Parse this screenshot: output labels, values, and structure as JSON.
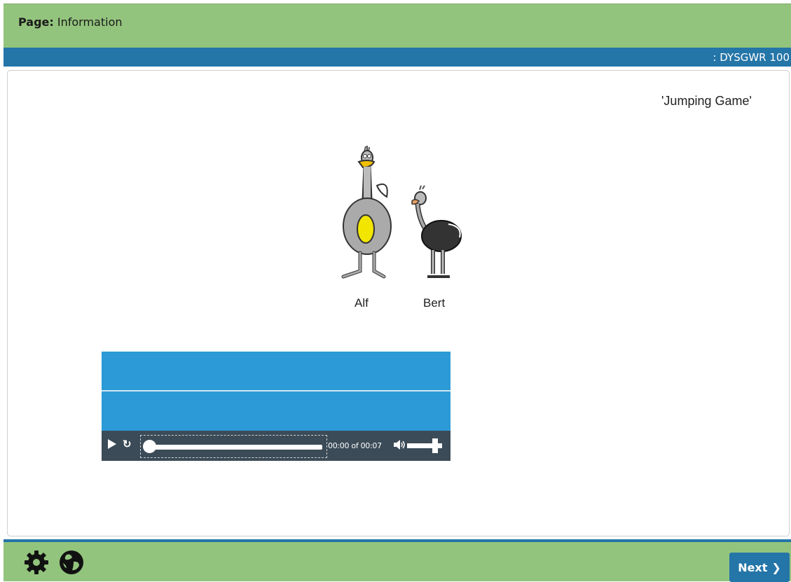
{
  "header": {
    "page_prefix": "Page:",
    "page_name": "Information",
    "course_code": ": DYSGWR 100"
  },
  "content": {
    "title": "'Jumping Game'",
    "characters": [
      {
        "name": "Alf",
        "icon": "tall-grey-ostrich-illustration"
      },
      {
        "name": "Bert",
        "icon": "small-black-ostrich-illustration"
      }
    ]
  },
  "player": {
    "time": "00:00 of 00:07",
    "progress": 0,
    "volume": 0.8,
    "icons": [
      "play-icon",
      "repeat-icon",
      "volume-icon"
    ]
  },
  "footer": {
    "icons": [
      "gear-icon",
      "globe-icon"
    ],
    "next_label": "Next",
    "next_icon": "chevron-right-icon"
  },
  "colors": {
    "header_green": "#93c47d",
    "accent_blue": "#2475a8",
    "player_blue": "#2b9ad6",
    "controls_dark": "#3b4b57"
  }
}
